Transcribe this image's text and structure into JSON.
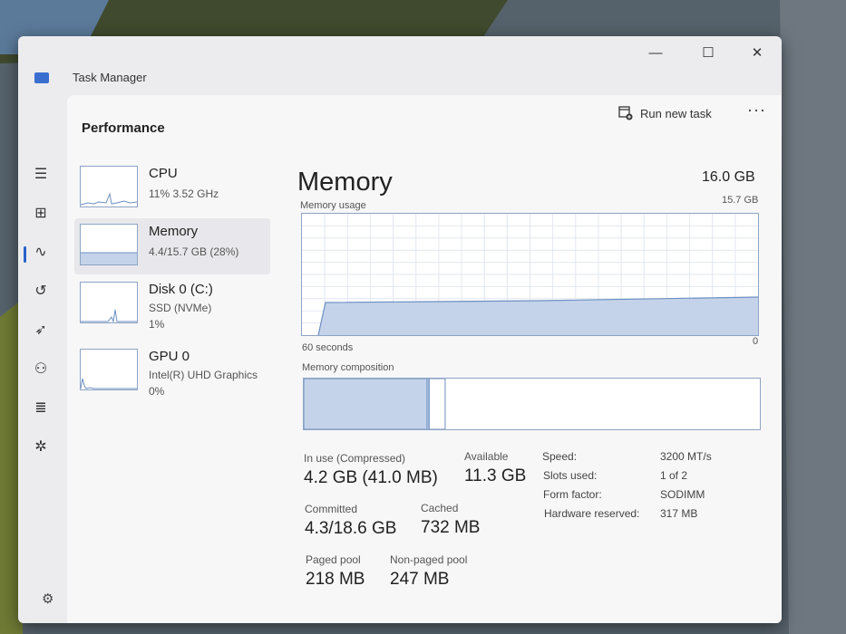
{
  "app": {
    "title": "Task Manager"
  },
  "window_controls": {
    "minimize": "—",
    "maximize": "☐",
    "close": "✕"
  },
  "nav_icons": [
    {
      "name": "hamburger-menu-icon",
      "glyph": "☰"
    },
    {
      "name": "processes-icon",
      "glyph": "⊞"
    },
    {
      "name": "performance-icon",
      "glyph": "∿"
    },
    {
      "name": "app-history-icon",
      "glyph": "↺"
    },
    {
      "name": "startup-apps-icon",
      "glyph": "➶"
    },
    {
      "name": "users-icon",
      "glyph": "⚇"
    },
    {
      "name": "details-icon",
      "glyph": "≣"
    },
    {
      "name": "services-icon",
      "glyph": "✲"
    }
  ],
  "settings_icon": "⚙",
  "header": {
    "page_title": "Performance",
    "run_task_label": "Run new task",
    "more": "···"
  },
  "perf_items": [
    {
      "name": "CPU",
      "sub1": "11%  3.52 GHz",
      "sub2": ""
    },
    {
      "name": "Memory",
      "sub1": "4.4/15.7 GB (28%)",
      "sub2": ""
    },
    {
      "name": "Disk 0 (C:)",
      "sub1": "SSD (NVMe)",
      "sub2": "1%"
    },
    {
      "name": "GPU 0",
      "sub1": "Intel(R) UHD Graphics",
      "sub2": "0%"
    }
  ],
  "memory": {
    "title": "Memory",
    "total": "16.0 GB",
    "graph_max": "15.7 GB",
    "usage_label": "Memory usage",
    "time_label": "60 seconds",
    "zero_label": "0",
    "composition_label": "Memory composition",
    "composition": {
      "in_use": 0.27,
      "modified": 0.005,
      "standby": 0.035
    }
  },
  "stats": {
    "in_use_label": "In use (Compressed)",
    "in_use_value": "4.2 GB (41.0 MB)",
    "available_label": "Available",
    "available_value": "11.3 GB",
    "committed_label": "Committed",
    "committed_value": "4.3/18.6 GB",
    "cached_label": "Cached",
    "cached_value": "732 MB",
    "paged_label": "Paged pool",
    "paged_value": "218 MB",
    "nonpaged_label": "Non-paged pool",
    "nonpaged_value": "247 MB"
  },
  "specs": {
    "speed_label": "Speed:",
    "speed_value": "3200 MT/s",
    "slots_label": "Slots used:",
    "slots_value": "1 of 2",
    "form_label": "Form factor:",
    "form_value": "SODIMM",
    "reserved_label": "Hardware reserved:",
    "reserved_value": "317 MB"
  },
  "colors": {
    "accent": "#2a62c9",
    "graph_fill": "#c4d3ea",
    "graph_line": "#6d8fc2",
    "grid": "#e2e7ef"
  }
}
